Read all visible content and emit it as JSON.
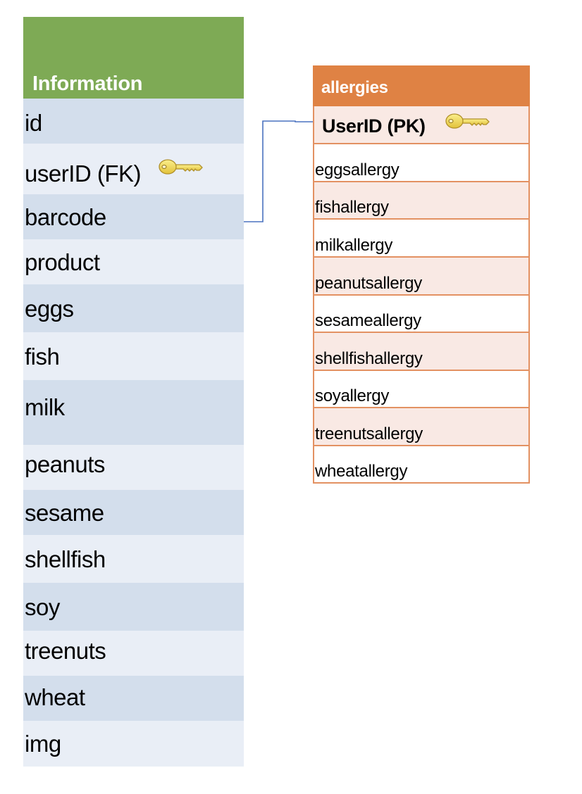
{
  "information_table": {
    "title": "Information",
    "header_color": "#7eaa55",
    "fields": [
      {
        "name": "id"
      },
      {
        "name": "userID (FK)",
        "icon": "key-icon"
      },
      {
        "name": "barcode"
      },
      {
        "name": "product"
      },
      {
        "name": "eggs"
      },
      {
        "name": "fish"
      },
      {
        "name": "milk"
      },
      {
        "name": "peanuts"
      },
      {
        "name": "sesame"
      },
      {
        "name": "shellfish"
      },
      {
        "name": "soy"
      },
      {
        "name": "treenuts"
      },
      {
        "name": "wheat"
      },
      {
        "name": "img"
      }
    ]
  },
  "allergies_table": {
    "title": "allergies",
    "header_color": "#df8244",
    "primary_key": {
      "name": "UserID (PK)",
      "icon": "key-icon"
    },
    "fields": [
      {
        "name": "eggsallergy"
      },
      {
        "name": "fishallergy"
      },
      {
        "name": "milkallergy"
      },
      {
        "name": "peanutsallergy"
      },
      {
        "name": "sesameallergy"
      },
      {
        "name": "shellfishallergy"
      },
      {
        "name": "soyallergy"
      },
      {
        "name": "treenutsallergy"
      },
      {
        "name": "wheatallergy"
      }
    ]
  },
  "relationship": {
    "from": "Information.barcode",
    "to": "allergies.UserID (PK)",
    "line_color": "#4a72c0"
  }
}
